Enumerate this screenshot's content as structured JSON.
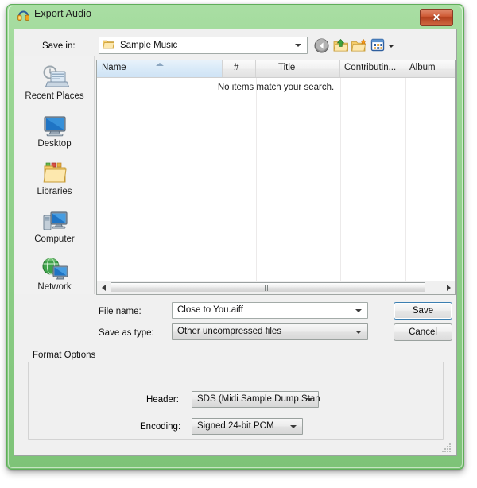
{
  "window": {
    "title": "Export Audio",
    "title_icon": "audacity-headphones-icon",
    "close_label": "✕",
    "accent_frame_color": "#8ccd86",
    "close_button_color": "#c2522d"
  },
  "navbar": {
    "save_in_label": "Save in:",
    "current_folder": "Sample Music",
    "folder_icon": "folder-icon",
    "buttons": [
      {
        "name": "back-button",
        "icon": "back-arrow-icon"
      },
      {
        "name": "up-one-level-button",
        "icon": "folder-up-icon"
      },
      {
        "name": "new-folder-button",
        "icon": "new-folder-icon"
      },
      {
        "name": "views-button",
        "icon": "views-grid-icon"
      }
    ]
  },
  "places": {
    "items": [
      {
        "label": "Recent Places",
        "icon": "recent-places-icon"
      },
      {
        "label": "Desktop",
        "icon": "desktop-icon"
      },
      {
        "label": "Libraries",
        "icon": "libraries-icon"
      },
      {
        "label": "Computer",
        "icon": "computer-icon"
      },
      {
        "label": "Network",
        "icon": "network-icon"
      }
    ]
  },
  "filelist": {
    "columns": [
      {
        "label": "Name",
        "sorted": true
      },
      {
        "label": "#",
        "sorted": false
      },
      {
        "label": "Title",
        "sorted": false
      },
      {
        "label": "Contributin...",
        "sorted": false
      },
      {
        "label": "Album",
        "sorted": false
      }
    ],
    "empty_message": "No items match your search."
  },
  "form": {
    "file_name_label": "File name:",
    "file_name_value": "Close to You.aiff",
    "save_as_type_label": "Save as type:",
    "save_as_type_value": "Other uncompressed files",
    "save_button": "Save",
    "cancel_button": "Cancel"
  },
  "format_options": {
    "group_title": "Format Options",
    "header_label": "Header:",
    "header_value": "SDS (Midi Sample Dump Stan",
    "encoding_label": "Encoding:",
    "encoding_value": "Signed 24-bit PCM"
  }
}
